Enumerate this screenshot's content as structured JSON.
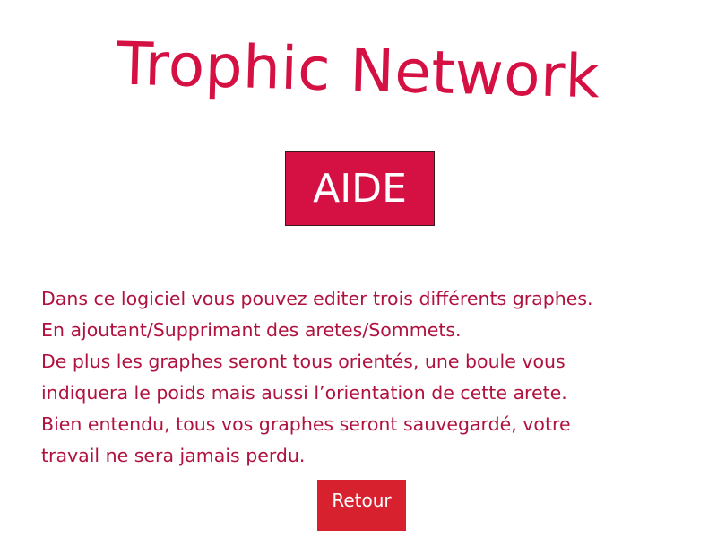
{
  "header": {
    "title": "Trophic Network",
    "badge": "AIDE"
  },
  "help": {
    "lines": [
      "Dans ce logiciel vous pouvez editer trois différents graphes.",
      "En ajoutant/Supprimant des aretes/Sommets.",
      "De plus les graphes seront tous orientés, une boule vous",
      "indiquera le poids mais aussi l’orientation de cette arete.",
      "Bien entendu, tous vos graphes seront sauvegardé, votre",
      "travail ne sera jamais perdu."
    ]
  },
  "actions": {
    "back_label": "Retour"
  },
  "colors": {
    "brand": "#d51043",
    "text": "#b0123f",
    "button": "#d8212f",
    "background": "#ffffff"
  }
}
